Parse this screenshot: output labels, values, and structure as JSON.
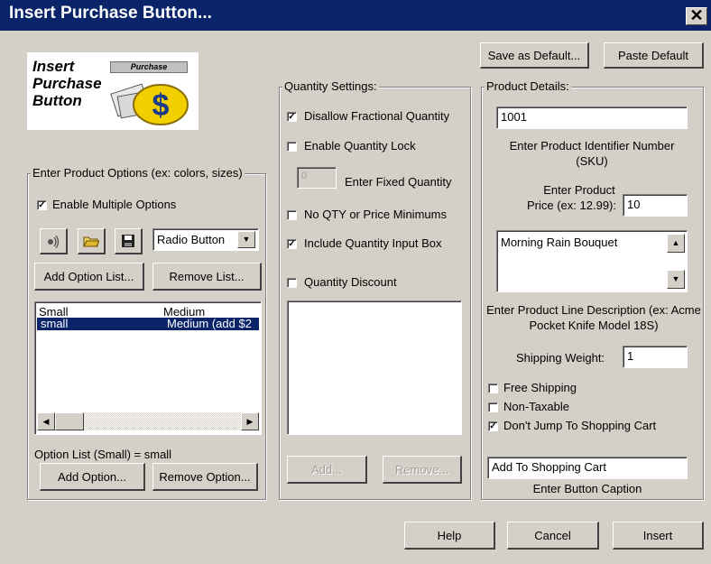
{
  "window": {
    "title": "Insert Purchase Button...",
    "close_glyph": "✕"
  },
  "logo": {
    "line1": "Insert",
    "line2": "Purchase",
    "line3": "Button",
    "badge": "Purchase"
  },
  "top_buttons": {
    "save_default": "Save as Default...",
    "paste_default": "Paste Default"
  },
  "options_group": {
    "label": "Enter Product Options (ex: colors, sizes)",
    "enable_multiple": {
      "label": "Enable Multiple Options",
      "checked": true
    },
    "style_select": "Radio Button",
    "add_list": "Add Option List...",
    "remove_list": "Remove List...",
    "list_headers": [
      "Small",
      "Medium"
    ],
    "list_rows": [
      [
        "small",
        "Medium (add $2"
      ]
    ],
    "status": "Option List (Small) = small",
    "add_option": "Add Option...",
    "remove_option": "Remove Option..."
  },
  "quantity_group": {
    "label": "Quantity Settings:",
    "disallow_fractional": {
      "label": "Disallow Fractional Quantity",
      "checked": true
    },
    "enable_lock": {
      "label": "Enable Quantity Lock",
      "checked": false
    },
    "fixed_qty_value": "0",
    "fixed_qty_label": "Enter Fixed Quantity",
    "no_minimums": {
      "label": "No QTY or Price Minimums",
      "checked": false
    },
    "include_input_box": {
      "label": "Include Quantity Input Box",
      "checked": true
    },
    "discount": {
      "label": "Quantity Discount",
      "checked": false
    },
    "add": "Add...",
    "remove": "Remove..."
  },
  "product_group": {
    "label": "Product Details:",
    "sku_value": "1001",
    "sku_caption": "Enter Product Identifier Number (SKU)",
    "price_caption_line1": "Enter Product",
    "price_caption_line2": "Price (ex: 12.99):",
    "price_value": "10",
    "description_value": "Morning Rain Bouquet",
    "description_caption": "Enter Product Line Description (ex: Acme Pocket Knife Model 18S)",
    "weight_label": "Shipping Weight:",
    "weight_value": "1",
    "free_shipping": {
      "label": "Free Shipping",
      "checked": false
    },
    "non_taxable": {
      "label": "Non-Taxable",
      "checked": false
    },
    "dont_jump": {
      "label": "Don't Jump To Shopping Cart",
      "checked": true
    },
    "caption_value": "Add To Shopping Cart",
    "caption_label": "Enter Button Caption"
  },
  "bottom_buttons": {
    "help": "Help",
    "cancel": "Cancel",
    "insert": "Insert"
  }
}
